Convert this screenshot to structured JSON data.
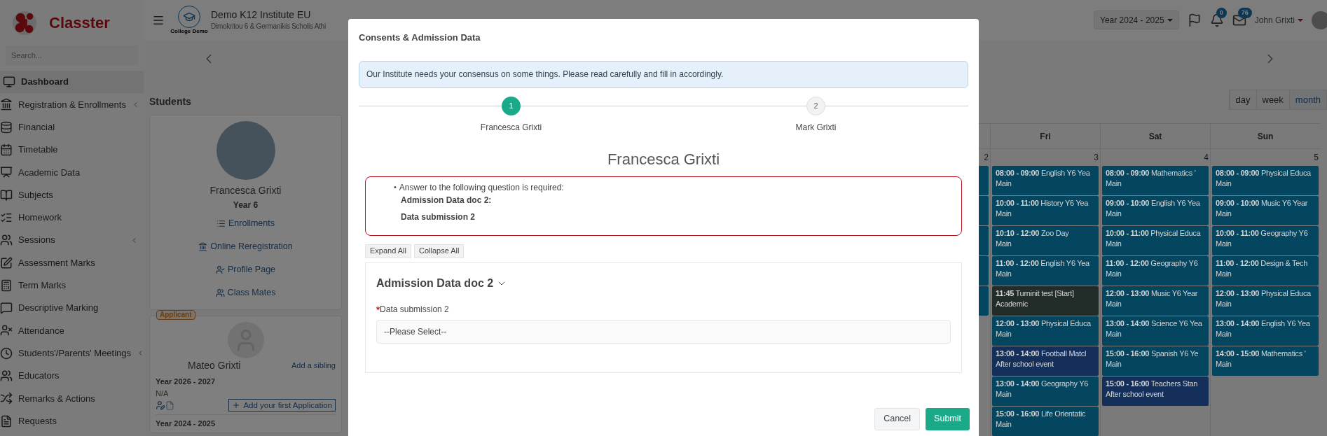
{
  "sidebar": {
    "brand": "Classter",
    "search": {
      "placeholder": "Search..."
    },
    "items": [
      {
        "label": "Dashboard",
        "selected": true,
        "expandable": false
      },
      {
        "label": "Registration & Enrollments",
        "selected": false,
        "expandable": true
      },
      {
        "label": "Financial",
        "selected": false,
        "expandable": false
      },
      {
        "label": "Timetable",
        "selected": false,
        "expandable": false
      },
      {
        "label": "Academic Data",
        "selected": false,
        "expandable": false
      },
      {
        "label": "Subjects",
        "selected": false,
        "expandable": false
      },
      {
        "label": "Homework",
        "selected": false,
        "expandable": false
      },
      {
        "label": "Sessions",
        "selected": false,
        "expandable": true
      },
      {
        "label": "Assessment Marks",
        "selected": false,
        "expandable": false
      },
      {
        "label": "Term Marks",
        "selected": false,
        "expandable": false
      },
      {
        "label": "Descriptive Marking",
        "selected": false,
        "expandable": false
      },
      {
        "label": "Attendance",
        "selected": false,
        "expandable": false
      },
      {
        "label": "Students'/Parents' Meetings",
        "selected": false,
        "expandable": true
      },
      {
        "label": "Educators",
        "selected": false,
        "expandable": false
      },
      {
        "label": "Remarks & Actions",
        "selected": false,
        "expandable": false
      },
      {
        "label": "Requests",
        "selected": false,
        "expandable": false
      }
    ]
  },
  "header": {
    "institute": "Demo K12 Institute EU",
    "address": "Dimokritou 6 & Germanikis Scholis Athi",
    "logo_caption": "College Demo",
    "year_selector": "Year 2024 - 2025",
    "notifications": "0",
    "messages": "76",
    "user": "John Grixti"
  },
  "students": {
    "title": "Students",
    "current": {
      "name": "Francesca Grixti",
      "class": "Year 6",
      "links": [
        "Enrollments",
        "Online Reregistration",
        "Profile Page",
        "Class Mates"
      ]
    },
    "sibling": {
      "badge": "Applicant",
      "name": "Mateo Grixti",
      "add_link": "Add a sibling",
      "years": [
        {
          "year": "Year 2026 - 2027",
          "value": "N/A",
          "action": "Add your first Application"
        },
        {
          "year": "Year 2024 - 2025"
        }
      ]
    }
  },
  "calendar": {
    "views": [
      {
        "label": "day",
        "selected": false
      },
      {
        "label": "week",
        "selected": false
      },
      {
        "label": "month",
        "selected": true
      }
    ],
    "columns": [
      {
        "day": "2",
        "events": [
          {
            "color": "#044660"
          },
          {
            "color": "#044660"
          },
          {
            "color": "#044660"
          },
          {
            "color": "#044660"
          },
          {
            "color": "#044660"
          }
        ]
      },
      {
        "label": "Fri",
        "day": "3",
        "events": [
          {
            "time": "08:00 - 09:00",
            "title": "English Y6 Yea",
            "place": "Main",
            "color": "#044660"
          },
          {
            "time": "10:00 - 11:00",
            "title": "History Y6 Yea",
            "place": "Main",
            "color": "#044660"
          },
          {
            "time": "10:10 - 12:00",
            "title": "Zoo Day",
            "place": "Main",
            "color": "#044660"
          },
          {
            "time": "11:00 - 12:00",
            "title": "English Y6 Yea",
            "place": "Main",
            "color": "#044660"
          },
          {
            "time": "11:45",
            "title": "Turninit test [Start]",
            "place": "Academic",
            "color": "#222c28"
          },
          {
            "time": "12:00 - 13:00",
            "title": "Physical Educa",
            "place": "Main",
            "color": "#044660"
          },
          {
            "time": "13:00 - 14:00",
            "title": "Football Matcl",
            "place": "After school event",
            "color": "#14305a"
          },
          {
            "time": "13:00 - 14:00",
            "title": "Geography Y6",
            "place": "Main",
            "color": "#044660"
          },
          {
            "time": "15:00 - 16:00",
            "title": "Life Orientatic",
            "place": "Main",
            "color": "#044660"
          }
        ]
      },
      {
        "label": "Sat",
        "day": "4",
        "events": [
          {
            "time": "08:00 - 09:00",
            "title": "Mathematics '",
            "place": "Main",
            "color": "#044660"
          },
          {
            "time": "09:00 - 10:00",
            "title": "English Y6 Yea",
            "place": "Main",
            "color": "#044660"
          },
          {
            "time": "10:00 - 11:00",
            "title": "Physical Educa",
            "place": "Main",
            "color": "#044660"
          },
          {
            "time": "11:00 - 12:00",
            "title": "Geography Y6",
            "place": "Main",
            "color": "#044660"
          },
          {
            "time": "12:00 - 13:00",
            "title": "Music Y6 Year",
            "place": "Main",
            "color": "#044660"
          },
          {
            "time": "13:00 - 14:00",
            "title": "Science Y6 Yea",
            "place": "Main",
            "color": "#044660"
          },
          {
            "time": "15:00 - 16:00",
            "title": "Spanish Y6 Ye",
            "place": "Main",
            "color": "#044660"
          },
          {
            "time": "15:00 - 16:00",
            "title": "Teachers Stan",
            "place": "After school event",
            "color": "#14305a"
          }
        ]
      },
      {
        "label": "Sun",
        "day": "5",
        "events": [
          {
            "time": "08:00 - 09:00",
            "title": "Physical Educa",
            "place": "Main",
            "color": "#044660"
          },
          {
            "time": "09:00 - 10:00",
            "title": "Music Y6 Year",
            "place": "Main",
            "color": "#044660"
          },
          {
            "time": "10:00 - 11:00",
            "title": "Geography Y6",
            "place": "Main",
            "color": "#044660"
          },
          {
            "time": "11:00 - 12:00",
            "title": "Design & Tech",
            "place": "Main",
            "color": "#044660"
          },
          {
            "time": "12:00 - 13:00",
            "title": "Physical Educa",
            "place": "Main",
            "color": "#044660"
          },
          {
            "time": "13:00 - 14:00",
            "title": "English Y6 Yea",
            "place": "Main",
            "color": "#044660"
          },
          {
            "time": "14:00 - 15:00",
            "title": "Mathematics '",
            "place": "Main",
            "color": "#044660"
          }
        ]
      }
    ]
  },
  "modal": {
    "title": "Consents & Admission Data",
    "notice": "Our Institute needs your consensus on some things. Please read carefully and fill in accordingly.",
    "steps": [
      {
        "number": "1",
        "label": "Francesca Grixti",
        "selected": true
      },
      {
        "number": "2",
        "label": "Mark Grixti",
        "selected": false
      }
    ],
    "heading": "Francesca Grixti",
    "error": {
      "bullet": "•",
      "message": "Answer to the following question is required:",
      "lines": [
        "Admission Data doc 2:",
        "Data submission 2"
      ]
    },
    "toggles": [
      "Expand All",
      "Collapse All"
    ],
    "section": {
      "title": "Admission Data doc 2",
      "expanded": true,
      "field": {
        "required_mark": "*",
        "label": "Data submission 2",
        "placeholder": "--Please Select--"
      }
    },
    "buttons": [
      {
        "label": "Cancel",
        "kind": "secondary"
      },
      {
        "label": "Submit",
        "kind": "primary"
      }
    ]
  }
}
